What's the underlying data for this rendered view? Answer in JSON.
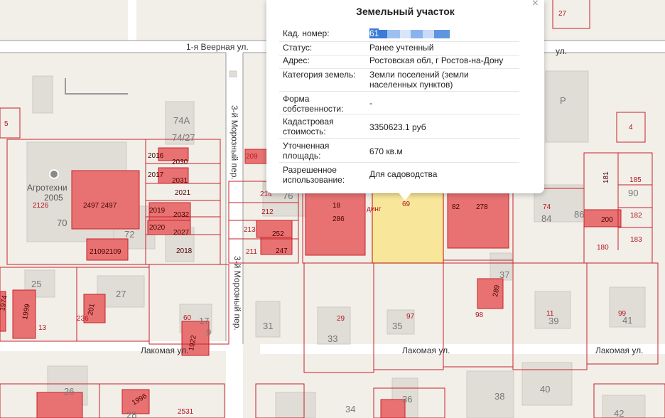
{
  "map": {
    "streets": {
      "veernaya": "1-я Веерная ул.",
      "veernaya2": "ул.",
      "moroznyi1": "3-й Морозный пер.",
      "moroznyi2": "3-й Морозный пер.",
      "lakomaya1": "Лакомая ул.",
      "lakomaya2": "Лакомая ул.",
      "lakomaya3": "Лакомая ул."
    },
    "poi": {
      "name": "Агротехни",
      "number": "2005",
      "building": "70"
    },
    "labels": {
      "n27top": "27",
      "n5": "5",
      "n4": "4",
      "n74a": "74А",
      "n7427": "74/27",
      "p": "Р",
      "n2016": "2016",
      "n2030": "2030",
      "n2017": "2017",
      "n2031": "2031",
      "n2021": "2021",
      "n2019": "2019",
      "n2032": "2032",
      "n2020": "2020",
      "n2027": "2027",
      "n2018": "2018",
      "n2126": "2126",
      "n24972497": "2497 2497",
      "n21092109": "21092109",
      "n72": "72",
      "n209": "209",
      "n214": "214",
      "n76": "76",
      "n212": "212",
      "n213": "213",
      "n252": "252",
      "n211": "211",
      "n247": "247",
      "n18": "18",
      "n286": "286",
      "ding": "динг",
      "n69": "69",
      "n82": "82",
      "n278": "278",
      "n74": "74",
      "n84": "84",
      "n86": "86",
      "n181": "181",
      "n185": "185",
      "n90": "90",
      "n200": "200",
      "n182": "182",
      "n180": "180",
      "n183": "183",
      "n25": "25",
      "n27": "27",
      "n1974": "1974",
      "n1999": "1999",
      "n13": "13",
      "n201": "201",
      "n236": "236",
      "n60": "60",
      "n17": "17",
      "n9": "9",
      "n1922": "1922",
      "n31": "31",
      "n29": "29",
      "n33": "33",
      "n97": "97",
      "n35": "35",
      "n37": "37",
      "n289": "289",
      "n98": "98",
      "n11": "11",
      "n39": "39",
      "n99": "99",
      "n41": "41",
      "n26": "26",
      "n1996": "1996",
      "n28": "28",
      "n2531": "2531",
      "n34": "34",
      "n36": "36",
      "n38": "38",
      "n40": "40",
      "n42": "42",
      "n1999b": "1999"
    }
  },
  "popup": {
    "title": "Земельный участок",
    "close": "×",
    "cadnum_visible": "61",
    "rows": [
      {
        "key": "Кад. номер:",
        "value": ""
      },
      {
        "key": "Статус:",
        "value": "Ранее учтенный"
      },
      {
        "key": "Адрес:",
        "value": "Ростовская обл, г Ростов-на-Дону"
      },
      {
        "key": "Категория земель:",
        "value": "Земли поселений (земли населенных пунктов)"
      },
      {
        "key": "Форма собственности:",
        "value": "-"
      },
      {
        "key": "Кадастровая стоимость:",
        "value": "3350623.1 руб"
      },
      {
        "key": "Уточненная площадь:",
        "value": "670 кв.м"
      },
      {
        "key": "Разрешенное использование:",
        "value": "Для садоводства"
      }
    ]
  },
  "colors": {
    "background": "#f2efe9",
    "building_gray": "#e0dcd6",
    "building_red": "#e87272",
    "parcel_border": "#c8202a",
    "selected_fill": "#f8e79a",
    "selected_border": "#e8c95a"
  }
}
